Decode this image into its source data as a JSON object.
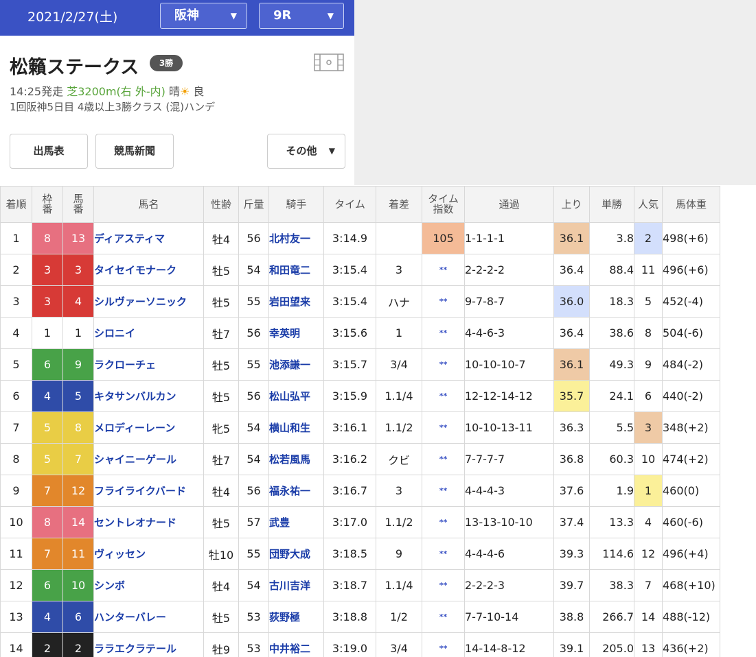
{
  "header": {
    "date": "2021/2/27(土)",
    "venue": "阪神",
    "race_no": "9R"
  },
  "race": {
    "title": "松籟ステークス",
    "grade": "3勝",
    "start": "14:25発走",
    "course": "芝3200m(右 外-内)",
    "weather": "晴",
    "weather_icon": "☀",
    "going": "良",
    "detail": "1回阪神5日目 4歳以上3勝クラス (混)ハンデ"
  },
  "buttons": {
    "entries": "出馬表",
    "newspaper": "競馬新聞",
    "other": "その他"
  },
  "table": {
    "headers": [
      "着順",
      "枠番",
      "馬番",
      "馬名",
      "性齢",
      "斤量",
      "騎手",
      "タイム",
      "着差",
      "タイム指数",
      "通過",
      "上り",
      "単勝",
      "人気",
      "馬体重"
    ],
    "header_lines": {
      "frame": [
        "枠",
        "番"
      ],
      "num": [
        "馬",
        "番"
      ],
      "index": [
        "タイム",
        "指数"
      ]
    },
    "rows": [
      {
        "pos": "1",
        "frame": "8",
        "num": "13",
        "name": "ディアスティマ",
        "sexage": "牡4",
        "weight": "56",
        "jockey": "北村友一",
        "time": "3:14.9",
        "margin": "",
        "index": "105",
        "pass": "1-1-1-1",
        "last": "36.1",
        "odds": "3.8",
        "pop": "2",
        "body": "498(+6)"
      },
      {
        "pos": "2",
        "frame": "3",
        "num": "3",
        "name": "タイセイモナーク",
        "sexage": "牡5",
        "weight": "54",
        "jockey": "和田竜二",
        "time": "3:15.4",
        "margin": "3",
        "index": "**",
        "pass": "2-2-2-2",
        "last": "36.4",
        "odds": "88.4",
        "pop": "11",
        "body": "496(+6)"
      },
      {
        "pos": "3",
        "frame": "3",
        "num": "4",
        "name": "シルヴァーソニック",
        "sexage": "牡5",
        "weight": "55",
        "jockey": "岩田望来",
        "time": "3:15.4",
        "margin": "ハナ",
        "index": "**",
        "pass": "9-7-8-7",
        "last": "36.0",
        "odds": "18.3",
        "pop": "5",
        "body": "452(-4)"
      },
      {
        "pos": "4",
        "frame": "1",
        "num": "1",
        "name": "シロニイ",
        "sexage": "牡7",
        "weight": "56",
        "jockey": "幸英明",
        "time": "3:15.6",
        "margin": "1",
        "index": "**",
        "pass": "4-4-6-3",
        "last": "36.4",
        "odds": "38.6",
        "pop": "8",
        "body": "504(-6)"
      },
      {
        "pos": "5",
        "frame": "6",
        "num": "9",
        "name": "ラクローチェ",
        "sexage": "牡5",
        "weight": "55",
        "jockey": "池添謙一",
        "time": "3:15.7",
        "margin": "3/4",
        "index": "**",
        "pass": "10-10-10-7",
        "last": "36.1",
        "odds": "49.3",
        "pop": "9",
        "body": "484(-2)"
      },
      {
        "pos": "6",
        "frame": "4",
        "num": "5",
        "name": "キタサンバルカン",
        "sexage": "牡5",
        "weight": "56",
        "jockey": "松山弘平",
        "time": "3:15.9",
        "margin": "1.1/4",
        "index": "**",
        "pass": "12-12-14-12",
        "last": "35.7",
        "odds": "24.1",
        "pop": "6",
        "body": "440(-2)"
      },
      {
        "pos": "7",
        "frame": "5",
        "num": "8",
        "name": "メロディーレーン",
        "sexage": "牝5",
        "weight": "54",
        "jockey": "横山和生",
        "time": "3:16.1",
        "margin": "1.1/2",
        "index": "**",
        "pass": "10-10-13-11",
        "last": "36.3",
        "odds": "5.5",
        "pop": "3",
        "body": "348(+2)"
      },
      {
        "pos": "8",
        "frame": "5",
        "num": "7",
        "name": "シャイニーゲール",
        "sexage": "牡7",
        "weight": "54",
        "jockey": "松若風馬",
        "time": "3:16.2",
        "margin": "クビ",
        "index": "**",
        "pass": "7-7-7-7",
        "last": "36.8",
        "odds": "60.3",
        "pop": "10",
        "body": "474(+2)"
      },
      {
        "pos": "9",
        "frame": "7",
        "num": "12",
        "name": "フライライクバード",
        "sexage": "牡4",
        "weight": "56",
        "jockey": "福永祐一",
        "time": "3:16.7",
        "margin": "3",
        "index": "**",
        "pass": "4-4-4-3",
        "last": "37.6",
        "odds": "1.9",
        "pop": "1",
        "body": "460(0)"
      },
      {
        "pos": "10",
        "frame": "8",
        "num": "14",
        "name": "セントレオナード",
        "sexage": "牡5",
        "weight": "57",
        "jockey": "武豊",
        "time": "3:17.0",
        "margin": "1.1/2",
        "index": "**",
        "pass": "13-13-10-10",
        "last": "37.4",
        "odds": "13.3",
        "pop": "4",
        "body": "460(-6)"
      },
      {
        "pos": "11",
        "frame": "7",
        "num": "11",
        "name": "ヴィッセン",
        "sexage": "牡10",
        "weight": "55",
        "jockey": "団野大成",
        "time": "3:18.5",
        "margin": "9",
        "index": "**",
        "pass": "4-4-4-6",
        "last": "39.3",
        "odds": "114.6",
        "pop": "12",
        "body": "496(+4)"
      },
      {
        "pos": "12",
        "frame": "6",
        "num": "10",
        "name": "シンボ",
        "sexage": "牡4",
        "weight": "54",
        "jockey": "古川吉洋",
        "time": "3:18.7",
        "margin": "1.1/4",
        "index": "**",
        "pass": "2-2-2-3",
        "last": "39.7",
        "odds": "38.3",
        "pop": "7",
        "body": "468(+10)"
      },
      {
        "pos": "13",
        "frame": "4",
        "num": "6",
        "name": "ハンターバレー",
        "sexage": "牡5",
        "weight": "53",
        "jockey": "荻野極",
        "time": "3:18.8",
        "margin": "1/2",
        "index": "**",
        "pass": "7-7-10-14",
        "last": "38.8",
        "odds": "266.7",
        "pop": "14",
        "body": "488(-12)"
      },
      {
        "pos": "14",
        "frame": "2",
        "num": "2",
        "name": "ララエクラテール",
        "sexage": "牡9",
        "weight": "53",
        "jockey": "中井裕二",
        "time": "3:19.0",
        "margin": "3/4",
        "index": "**",
        "pass": "14-14-8-12",
        "last": "39.1",
        "odds": "205.0",
        "pop": "13",
        "body": "436(+2)"
      }
    ]
  },
  "colors": {
    "header_bg": "#3a52c4",
    "link": "#1a3ca8",
    "index_highlight": "#f4bb97",
    "last3f_best": "#fbf099",
    "last3f_second": "#d3dffc",
    "last3f_third": "#efcaa6",
    "pop1": "#fbf099",
    "pop2": "#d3dffc",
    "pop3": "#efcaa6"
  },
  "icons": {
    "video": "film-icon",
    "dropdown": "triangle-down-icon",
    "weather": "sun-icon"
  }
}
